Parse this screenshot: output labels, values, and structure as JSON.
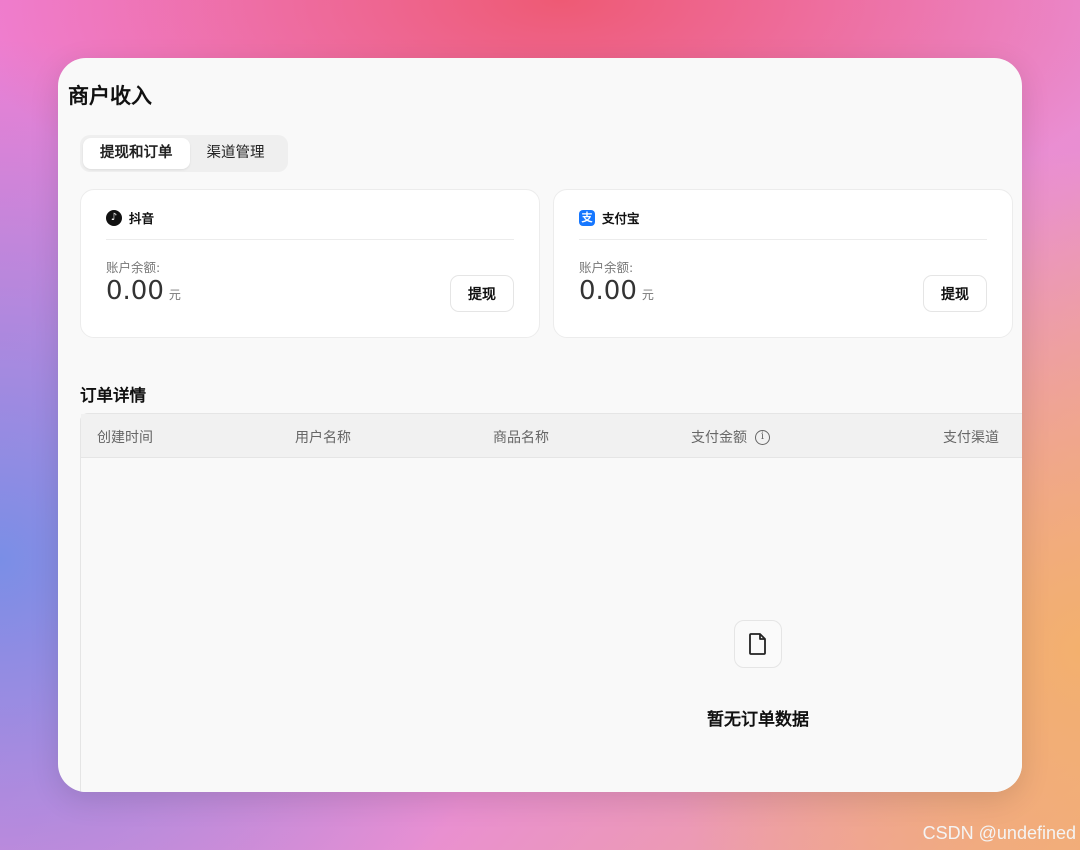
{
  "page": {
    "title": "商户收入"
  },
  "tabs": [
    {
      "label": "提现和订单",
      "active": true
    },
    {
      "label": "渠道管理",
      "active": false
    }
  ],
  "accounts": [
    {
      "name": "抖音",
      "icon": "douyin-icon",
      "balance_label": "账户余额:",
      "balance": "0.00",
      "unit": "元",
      "action": "提现"
    },
    {
      "name": "支付宝",
      "icon": "alipay-icon",
      "balance_label": "账户余额:",
      "balance": "0.00",
      "unit": "元",
      "action": "提现"
    }
  ],
  "orders": {
    "title": "订单详情",
    "columns": [
      "创建时间",
      "用户名称",
      "商品名称",
      "支付金额",
      "支付渠道"
    ],
    "empty_text": "暂无订单数据",
    "empty_icon": "file-icon"
  },
  "watermark": "CSDN @undefined"
}
